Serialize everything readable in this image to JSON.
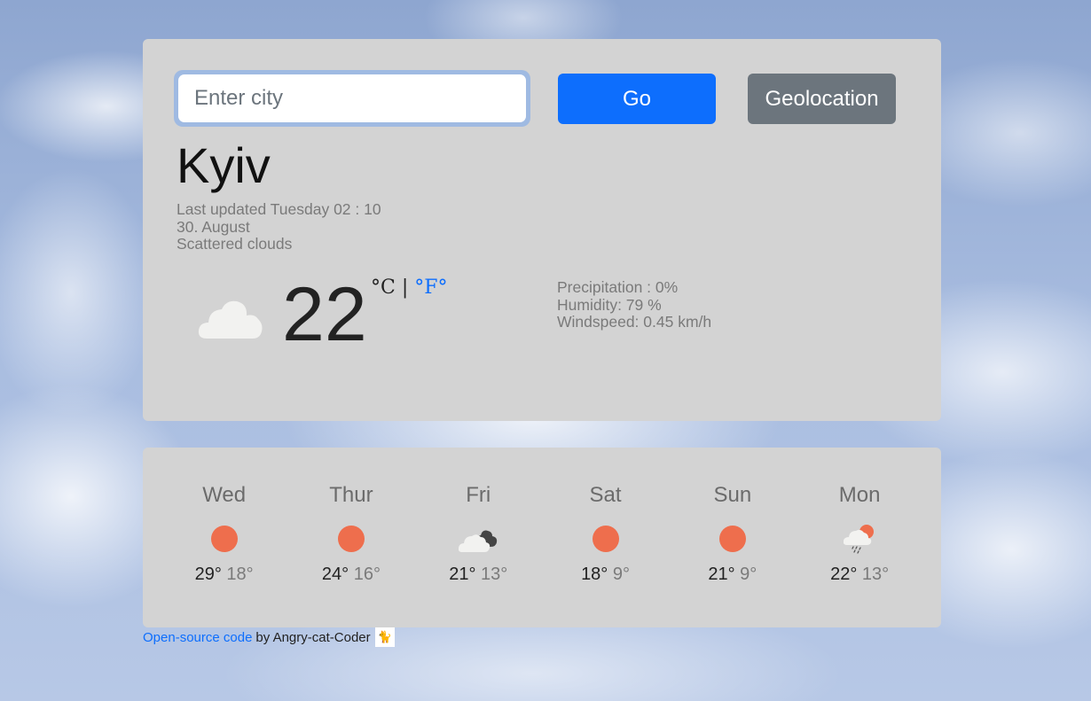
{
  "search": {
    "placeholder": "Enter city",
    "value": ""
  },
  "buttons": {
    "go_label": "Go",
    "geolocation_label": "Geolocation"
  },
  "current": {
    "city": "Kyiv",
    "last_updated": "Last updated Tuesday 02 : 10",
    "date": "30. August",
    "description": "Scattered clouds",
    "icon": "cloud-icon",
    "temperature": "22",
    "unit_celsius": "°C",
    "unit_separator": "|",
    "unit_fahrenheit": "°F°",
    "precipitation": "Precipitation : 0%",
    "humidity": "Humidity: 79 %",
    "windspeed": "Windspeed: 0.45 km/h"
  },
  "forecast": [
    {
      "day": "Wed",
      "icon": "sun-icon",
      "max": "29°",
      "min": "18°"
    },
    {
      "day": "Thur",
      "icon": "sun-icon",
      "max": "24°",
      "min": "16°"
    },
    {
      "day": "Fri",
      "icon": "broken-clouds-icon",
      "max": "21°",
      "min": "13°"
    },
    {
      "day": "Sat",
      "icon": "sun-icon",
      "max": "18°",
      "min": "9°"
    },
    {
      "day": "Sun",
      "icon": "sun-icon",
      "max": "21°",
      "min": "9°"
    },
    {
      "day": "Mon",
      "icon": "rain-sun-icon",
      "max": "22°",
      "min": "13°"
    }
  ],
  "footer": {
    "link_text": "Open-source code",
    "by_text": "by Angry-cat-Coder",
    "avatar_icon": "cat-avatar-icon"
  },
  "colors": {
    "primary": "#0d6efd",
    "secondary": "#6c757d",
    "card": "#d3d3d3",
    "sun": "#ee6e4d"
  }
}
